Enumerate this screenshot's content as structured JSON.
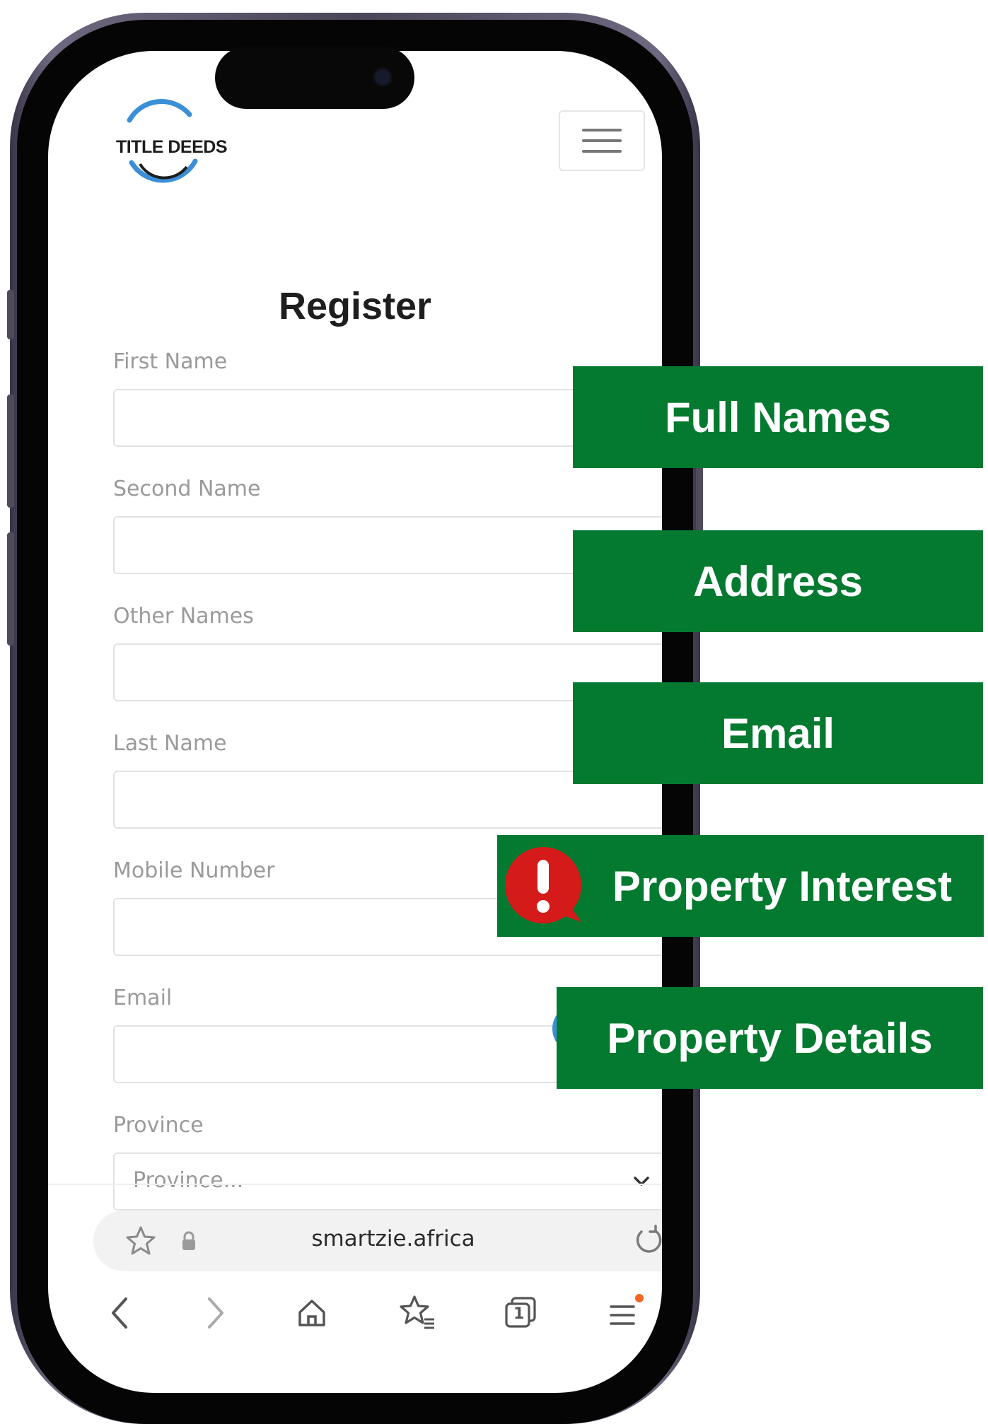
{
  "header": {
    "logo_text": "TITLE DEEDS"
  },
  "form": {
    "title": "Register",
    "fields": [
      {
        "label": "First Name",
        "value": ""
      },
      {
        "label": "Second Name",
        "value": ""
      },
      {
        "label": "Other Names",
        "value": ""
      },
      {
        "label": "Last Name",
        "value": ""
      },
      {
        "label": "Mobile Number",
        "value": ""
      },
      {
        "label": "Email",
        "value": ""
      }
    ],
    "province": {
      "label": "Province",
      "placeholder": "Province..."
    }
  },
  "browser": {
    "url": "smartzie.africa",
    "tab_count": "1"
  },
  "callouts": [
    "Full Names",
    "Address",
    "Email",
    "Property Interest",
    "Property Details"
  ],
  "colors": {
    "callout_green": "#037a2f",
    "alert_red": "#d51a1a",
    "logo_blue": "#3b8fd6"
  }
}
